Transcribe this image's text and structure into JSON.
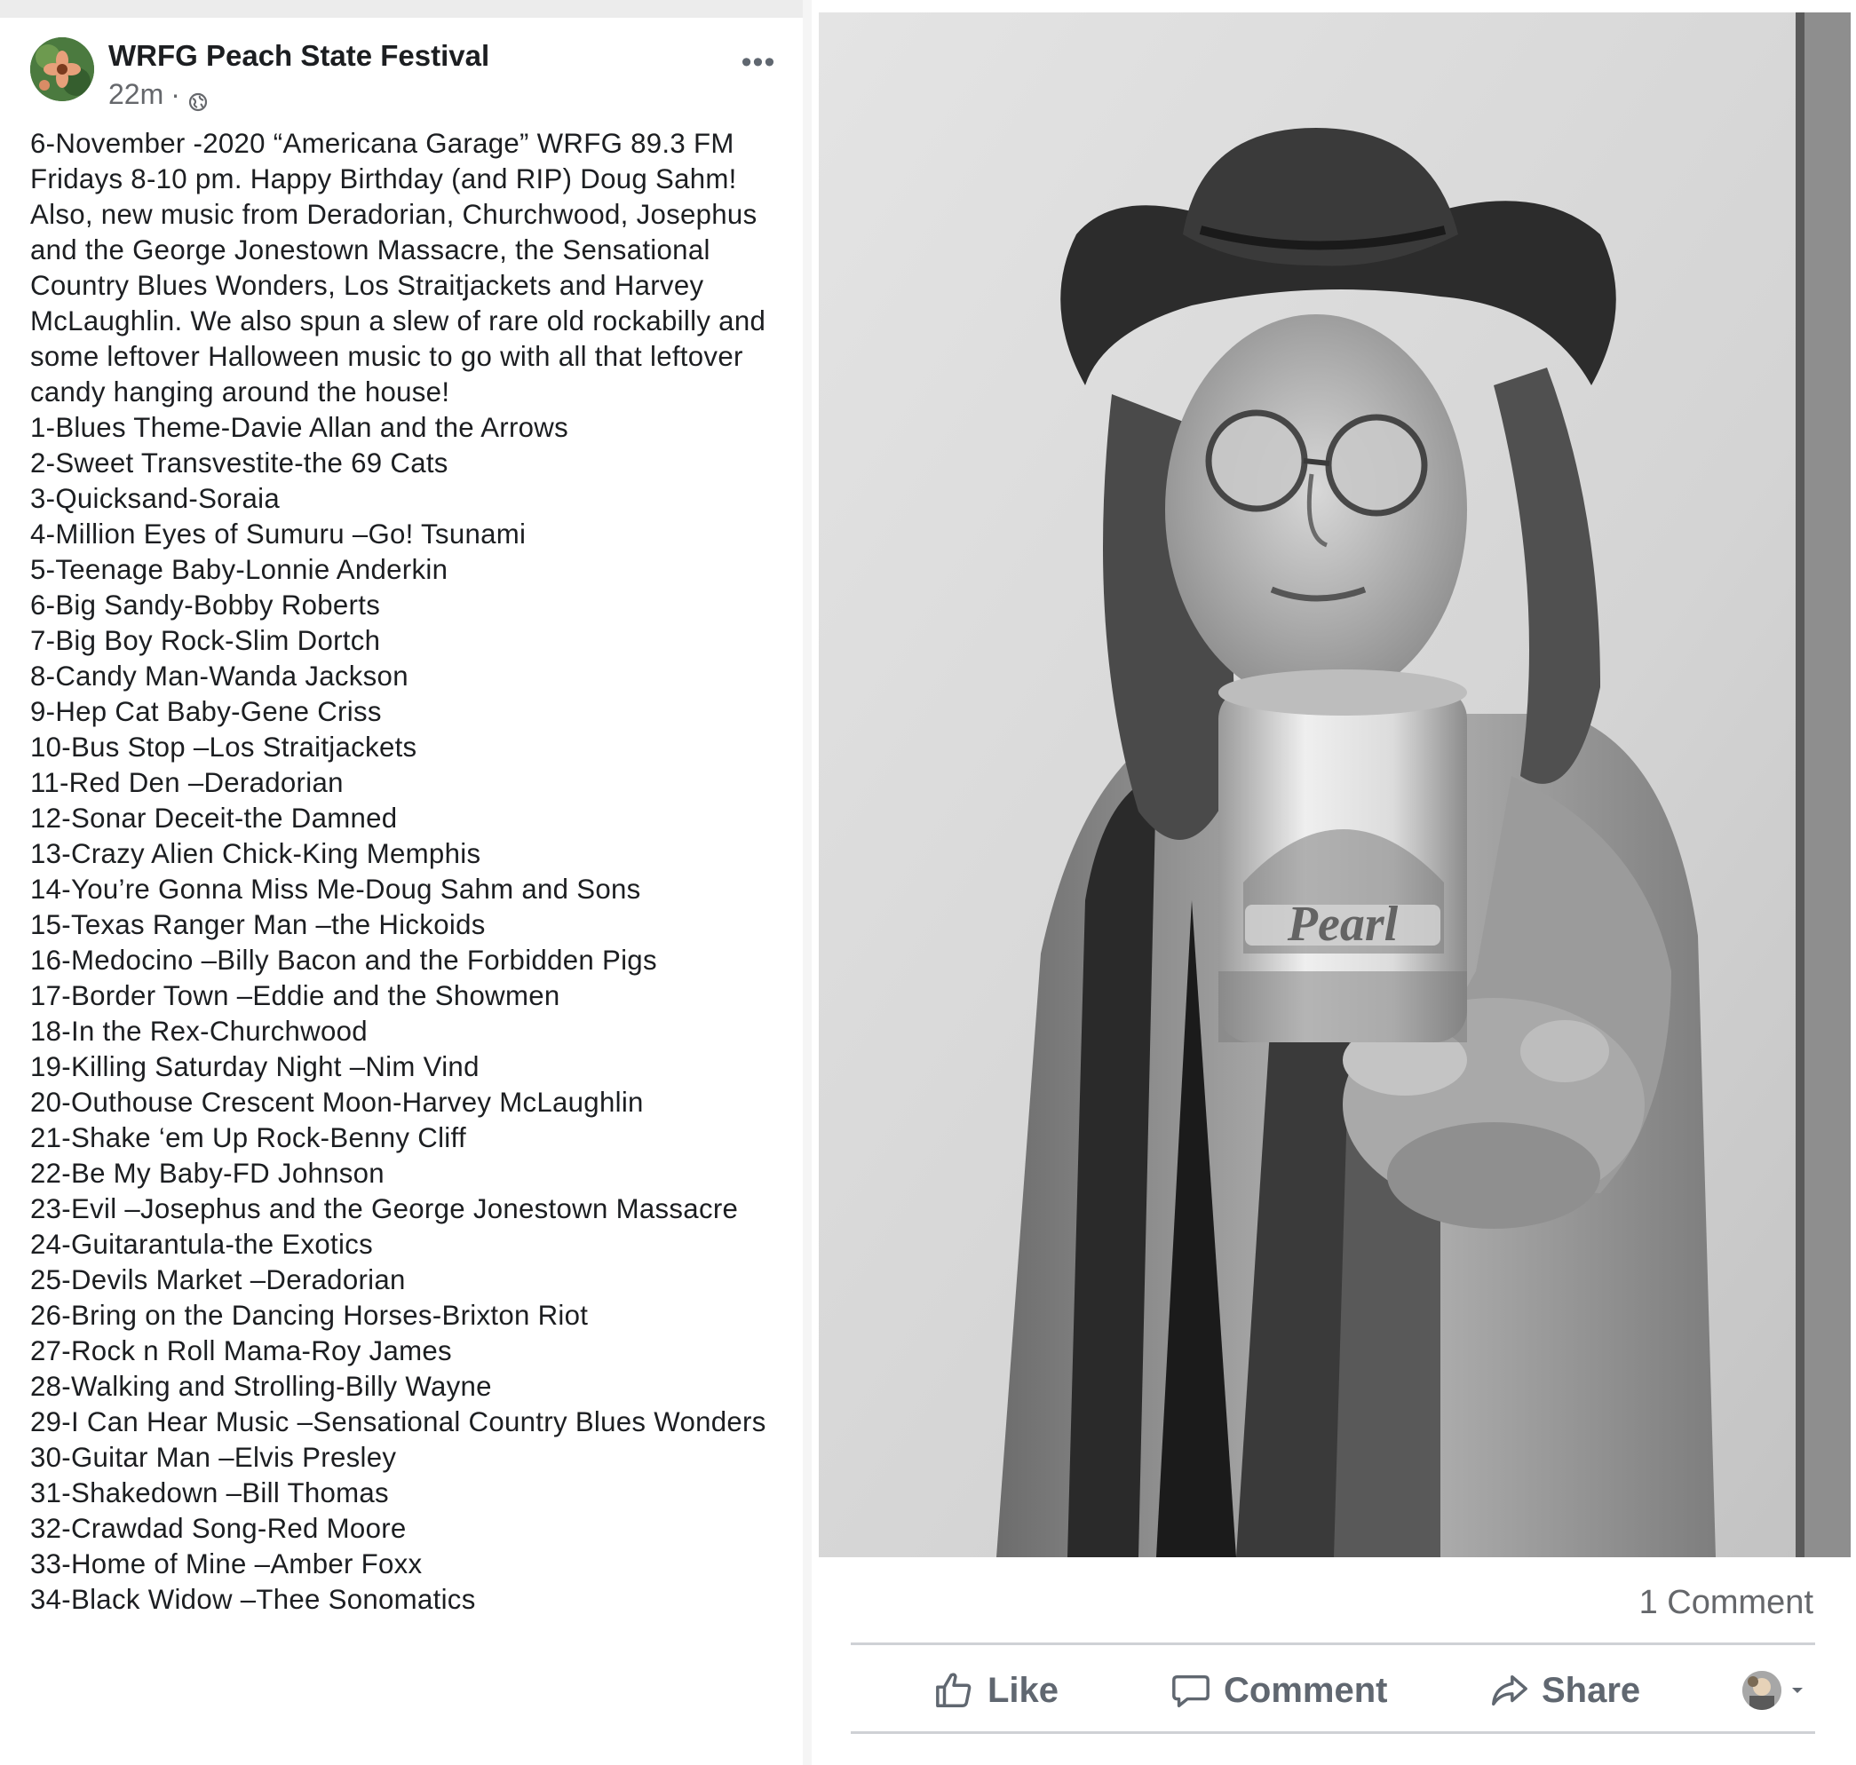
{
  "post": {
    "author": "WRFG Peach State Festival",
    "time": "22m",
    "separator": "·",
    "more_label": "•••",
    "intro": "6-November -2020 “Americana Garage” WRFG 89.3 FM Fridays 8-10 pm. Happy Birthday (and RIP) Doug Sahm! Also, new music from Deradorian, Churchwood, Josephus and the George Jonestown Massacre, the Sensational Country Blues Wonders, Los Straitjackets and Harvey McLaughlin. We also spun a slew of rare old rockabilly and some leftover Halloween music to go with all that leftover candy hanging around the house!",
    "tracks": [
      "1-Blues Theme-Davie Allan and the Arrows",
      "2-Sweet Transvestite-the 69 Cats",
      "3-Quicksand-Soraia",
      "4-Million Eyes of Sumuru –Go! Tsunami",
      "5-Teenage Baby-Lonnie Anderkin",
      "6-Big Sandy-Bobby Roberts",
      "7-Big Boy Rock-Slim Dortch",
      "8-Candy Man-Wanda Jackson",
      "9-Hep Cat Baby-Gene Criss",
      "10-Bus Stop –Los Straitjackets",
      "11-Red Den –Deradorian",
      "12-Sonar Deceit-the Damned",
      "13-Crazy Alien Chick-King Memphis",
      "14-You’re Gonna Miss Me-Doug Sahm and Sons",
      "15-Texas Ranger Man –the Hickoids",
      "16-Medocino –Billy Bacon and the Forbidden Pigs",
      "17-Border Town –Eddie and the Showmen",
      "18-In the Rex-Churchwood",
      "19-Killing Saturday Night –Nim Vind",
      "20-Outhouse Crescent Moon-Harvey McLaughlin",
      "21-Shake ‘em Up Rock-Benny Cliff",
      "22-Be My Baby-FD Johnson",
      "23-Evil –Josephus and the George Jonestown Massacre",
      "24-Guitarantula-the Exotics",
      "25-Devils Market –Deradorian",
      "26-Bring on the Dancing Horses-Brixton Riot",
      "27-Rock n Roll Mama-Roy James",
      "28-Walking and Strolling-Billy Wayne",
      "29-I Can Hear Music –Sensational Country Blues Wonders",
      "30-Guitar Man –Elvis Presley",
      "31-Shakedown –Bill Thomas",
      "32-Crawdad Song-Red Moore",
      "33-Home of Mine –Amber Foxx",
      "34-Black Widow –Thee Sonomatics"
    ],
    "photo_can_label": "Pearl"
  },
  "footer": {
    "comment_count": "1 Comment",
    "like_label": "Like",
    "comment_label": "Comment",
    "share_label": "Share"
  },
  "icons": {
    "globe": "globe-icon",
    "like": "thumbs-up-icon",
    "comment": "speech-bubble-icon",
    "share": "share-arrow-icon",
    "audience": "chevron-down-icon"
  },
  "colors": {
    "text": "#1c1e21",
    "muted": "#65676b",
    "action": "#606770",
    "divider": "#cfd1d5"
  }
}
